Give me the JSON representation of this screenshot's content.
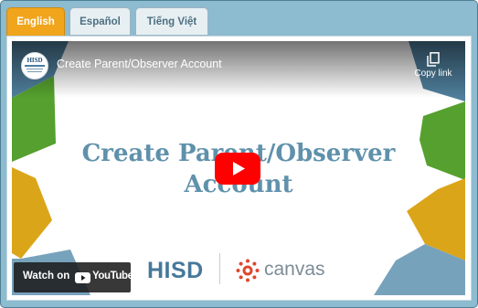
{
  "tabs": [
    {
      "label": "English",
      "active": true
    },
    {
      "label": "Español",
      "active": false
    },
    {
      "label": "Tiếng Việt",
      "active": false
    }
  ],
  "video": {
    "title": "Create Parent/Observer Account",
    "copy_link_label": "Copy link",
    "headline_line1": "Create Parent/Observer",
    "headline_line2": "Account",
    "brand_left": "HISD",
    "brand_right": "canvas",
    "channel_logo_text": "HISD",
    "watch_on_label": "Watch on",
    "youtube_label": "YouTube"
  },
  "colors": {
    "tab_active": "#f0a51d",
    "frame_bg": "#8dbbd0",
    "headline": "#5f91ab",
    "youtube_red": "#ff0000"
  }
}
